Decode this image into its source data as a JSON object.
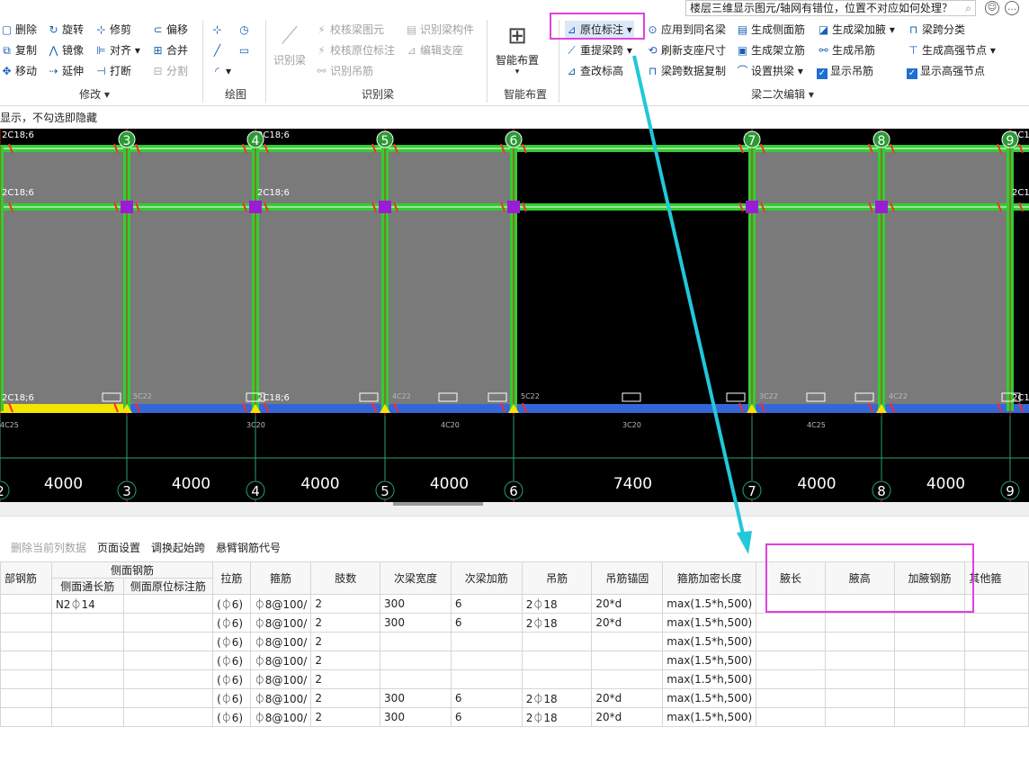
{
  "search": {
    "text": "楼层三维显示图元/轴网有错位，位置不对应如何处理？"
  },
  "ribbon": {
    "modify": {
      "delete": "删除",
      "rotate": "旋转",
      "trim": "修剪",
      "offset": "偏移",
      "copy": "复制",
      "mirror": "镜像",
      "align": "对齐",
      "merge": "合并",
      "move": "移动",
      "extend": "延伸",
      "break": "打断",
      "split": "分割",
      "group_label": "修改"
    },
    "draw": {
      "group_label": "绘图"
    },
    "identify": {
      "identify_beam": "识别梁",
      "check_beam": "校核梁图元",
      "identify_member": "识别梁构件",
      "check_inplace": "校核原位标注",
      "edit_support": "编辑支座",
      "identify_hanger": "识别吊筋",
      "group_label": "识别梁"
    },
    "smart": {
      "smart_layout": "智能布置",
      "group_label": "智能布置"
    },
    "edit": {
      "inplace_label": "原位标注",
      "apply_same": "应用到同名梁",
      "gen_side": "生成侧面筋",
      "gen_haunch": "生成梁加腋",
      "span_class": "梁跨分类",
      "relift_span": "重提梁跨",
      "refresh_support": "刷新支座尺寸",
      "gen_stirrup": "生成架立筋",
      "gen_hanger": "生成吊筋",
      "gen_node": "生成高强节点",
      "check_elev": "查改标高",
      "span_copy": "梁跨数据复制",
      "set_arch": "设置拱梁",
      "show_hanger": "显示吊筋",
      "show_node": "显示高强节点",
      "group_label": "梁二次编辑"
    }
  },
  "hint": "显示，不勾选即隐藏",
  "cad": {
    "axes": [
      "2",
      "3",
      "4",
      "5",
      "6",
      "7",
      "8",
      "9"
    ],
    "spans": [
      "4000",
      "4000",
      "4000",
      "4000",
      "7400",
      "4000",
      "4000"
    ],
    "rebar_label": "2C18;6",
    "bottom_labels": [
      "4C25",
      "3C20",
      "4C20",
      "3C20",
      "4C25"
    ],
    "col_labels": [
      "5C22",
      "4C22",
      "5C22",
      "3C22",
      "4C22"
    ]
  },
  "table_toolbar": {
    "delete_col": "删除当前列数据",
    "page_setup": "页面设置",
    "swap_start": "调换起始跨",
    "cantilever_code": "悬臂钢筋代号"
  },
  "table": {
    "headers": {
      "bottom_rebar": "部钢筋",
      "side_group": "侧面钢筋",
      "side_through": "侧面通长筋",
      "side_inplace": "侧面原位标注筋",
      "tie": "拉筋",
      "stirrup": "箍筋",
      "legs": "肢数",
      "sec_width": "次梁宽度",
      "sec_add": "次梁加筋",
      "hanger": "吊筋",
      "hanger_anchor": "吊筋锚固",
      "dense_len": "箍筋加密长度",
      "haunch_len": "腋长",
      "haunch_h": "腋高",
      "haunch_rebar": "加腋钢筋",
      "other": "其他箍"
    },
    "rows": [
      {
        "side_through": "N2⏀14",
        "tie": "(⏀6)",
        "stirrup": "⏀8@100/",
        "legs": "2",
        "sec_width": "300",
        "sec_add": "6",
        "hanger": "2⏀18",
        "anchor": "20*d",
        "dense": "max(1.5*h,500)"
      },
      {
        "side_through": "",
        "tie": "(⏀6)",
        "stirrup": "⏀8@100/",
        "legs": "2",
        "sec_width": "300",
        "sec_add": "6",
        "hanger": "2⏀18",
        "anchor": "20*d",
        "dense": "max(1.5*h,500)"
      },
      {
        "side_through": "",
        "tie": "(⏀6)",
        "stirrup": "⏀8@100/",
        "legs": "2",
        "sec_width": "",
        "sec_add": "",
        "hanger": "",
        "anchor": "",
        "dense": "max(1.5*h,500)"
      },
      {
        "side_through": "",
        "tie": "(⏀6)",
        "stirrup": "⏀8@100/",
        "legs": "2",
        "sec_width": "",
        "sec_add": "",
        "hanger": "",
        "anchor": "",
        "dense": "max(1.5*h,500)"
      },
      {
        "side_through": "",
        "tie": "(⏀6)",
        "stirrup": "⏀8@100/",
        "legs": "2",
        "sec_width": "",
        "sec_add": "",
        "hanger": "",
        "anchor": "",
        "dense": "max(1.5*h,500)"
      },
      {
        "side_through": "",
        "tie": "(⏀6)",
        "stirrup": "⏀8@100/",
        "legs": "2",
        "sec_width": "300",
        "sec_add": "6",
        "hanger": "2⏀18",
        "anchor": "20*d",
        "dense": "max(1.5*h,500)"
      },
      {
        "side_through": "",
        "tie": "(⏀6)",
        "stirrup": "⏀8@100/",
        "legs": "2",
        "sec_width": "300",
        "sec_add": "6",
        "hanger": "2⏀18",
        "anchor": "20*d",
        "dense": "max(1.5*h,500)"
      }
    ]
  },
  "colors": {
    "highlight": "#e040e0",
    "arrow": "#20c8d8",
    "beam": "#33cc33",
    "slab": "#7a7a7a"
  }
}
